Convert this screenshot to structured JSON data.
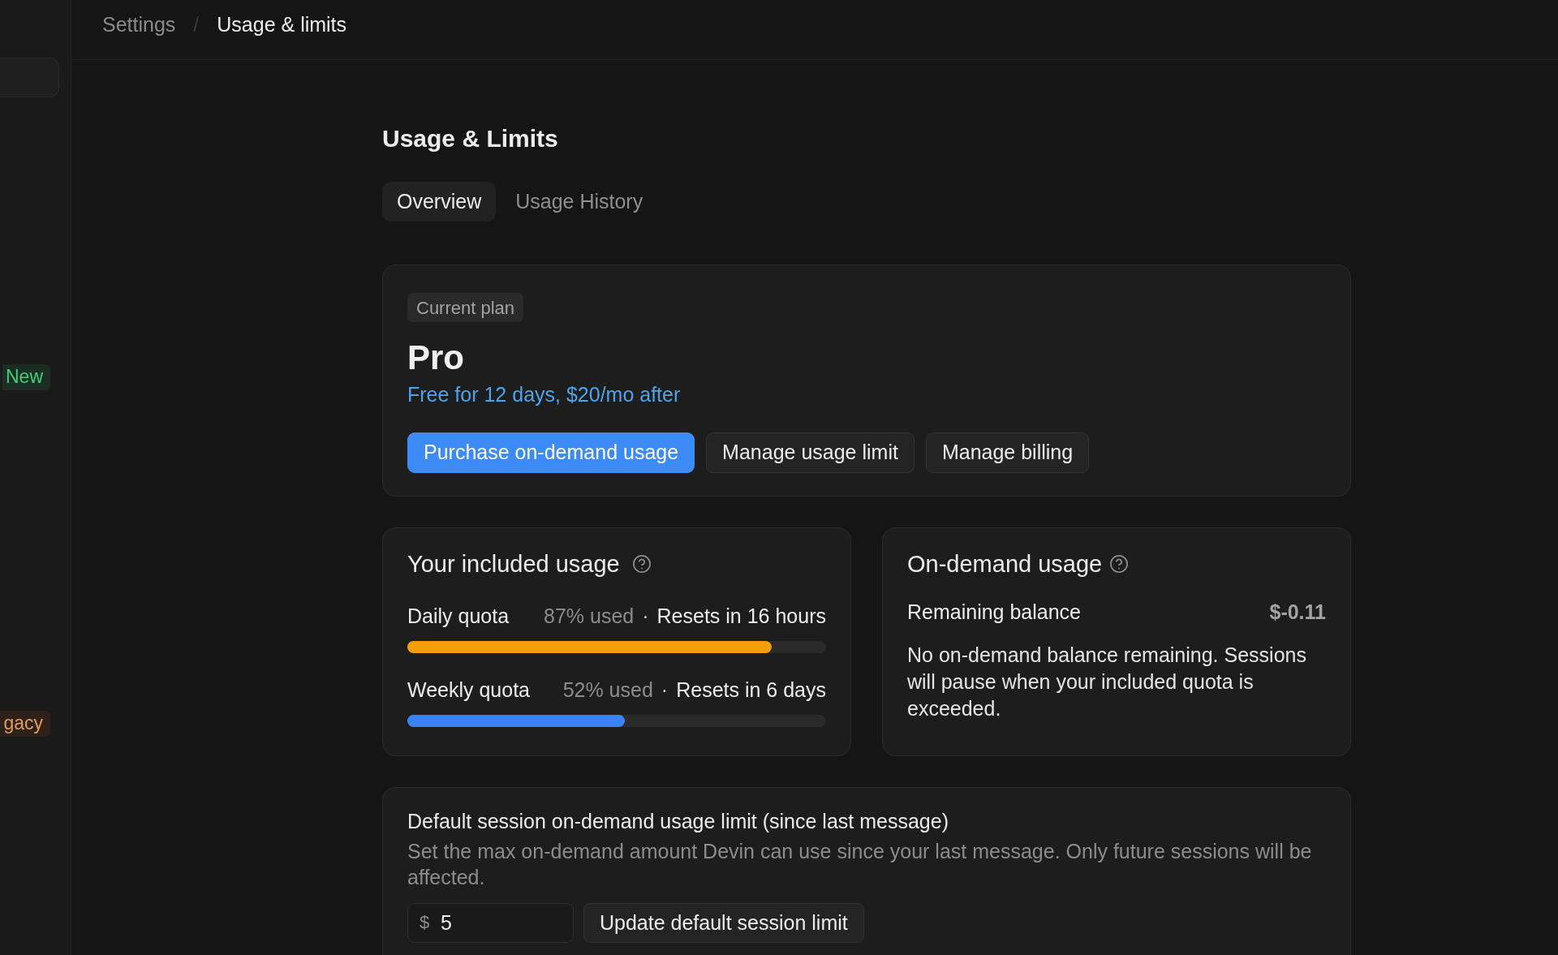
{
  "sidebar": {
    "items": [
      {
        "selected": true
      },
      {
        "selected": false,
        "badge": {
          "label": "New",
          "kind": "new"
        }
      },
      {
        "selected": false,
        "badge": {
          "label": "gacy",
          "kind": "legacy"
        }
      }
    ]
  },
  "breadcrumb": {
    "items": [
      {
        "label": "Settings",
        "selected": false
      },
      {
        "label": "Usage & limits",
        "selected": true
      }
    ],
    "separator": "/"
  },
  "page_title": "Usage & Limits",
  "tabs": [
    {
      "label": "Overview",
      "selected": true
    },
    {
      "label": "Usage History",
      "selected": false
    }
  ],
  "plan": {
    "badge": "Current plan",
    "name": "Pro",
    "note": "Free for 12 days, $20/mo after",
    "buttons": [
      {
        "label": "Purchase on-demand usage",
        "kind": "primary"
      },
      {
        "label": "Manage usage limit",
        "kind": "secondary"
      },
      {
        "label": "Manage billing",
        "kind": "secondary"
      }
    ]
  },
  "included_usage": {
    "title": "Your included usage",
    "quotas": [
      {
        "name": "Daily quota",
        "used": "87% used",
        "separator": "·",
        "resets": "Resets in 16 hours",
        "level": 0.87,
        "color": "#f59e0b"
      },
      {
        "name": "Weekly quota",
        "used": "52% used",
        "separator": "·",
        "resets": "Resets in 6 days",
        "level": 0.52,
        "color": "#3b82f6"
      }
    ]
  },
  "on_demand": {
    "title": "On-demand usage",
    "balance_label": "Remaining balance",
    "balance": "$-0.11",
    "message": "No on-demand balance remaining. Sessions will pause when your included quota is exceeded."
  },
  "session_limit": {
    "title": "Default session on-demand usage limit (since last message)",
    "description": "Set the max on-demand amount Devin can use since your last message. Only future sessions will be affected.",
    "currency": "$",
    "value": "5",
    "button": "Update default session limit"
  }
}
